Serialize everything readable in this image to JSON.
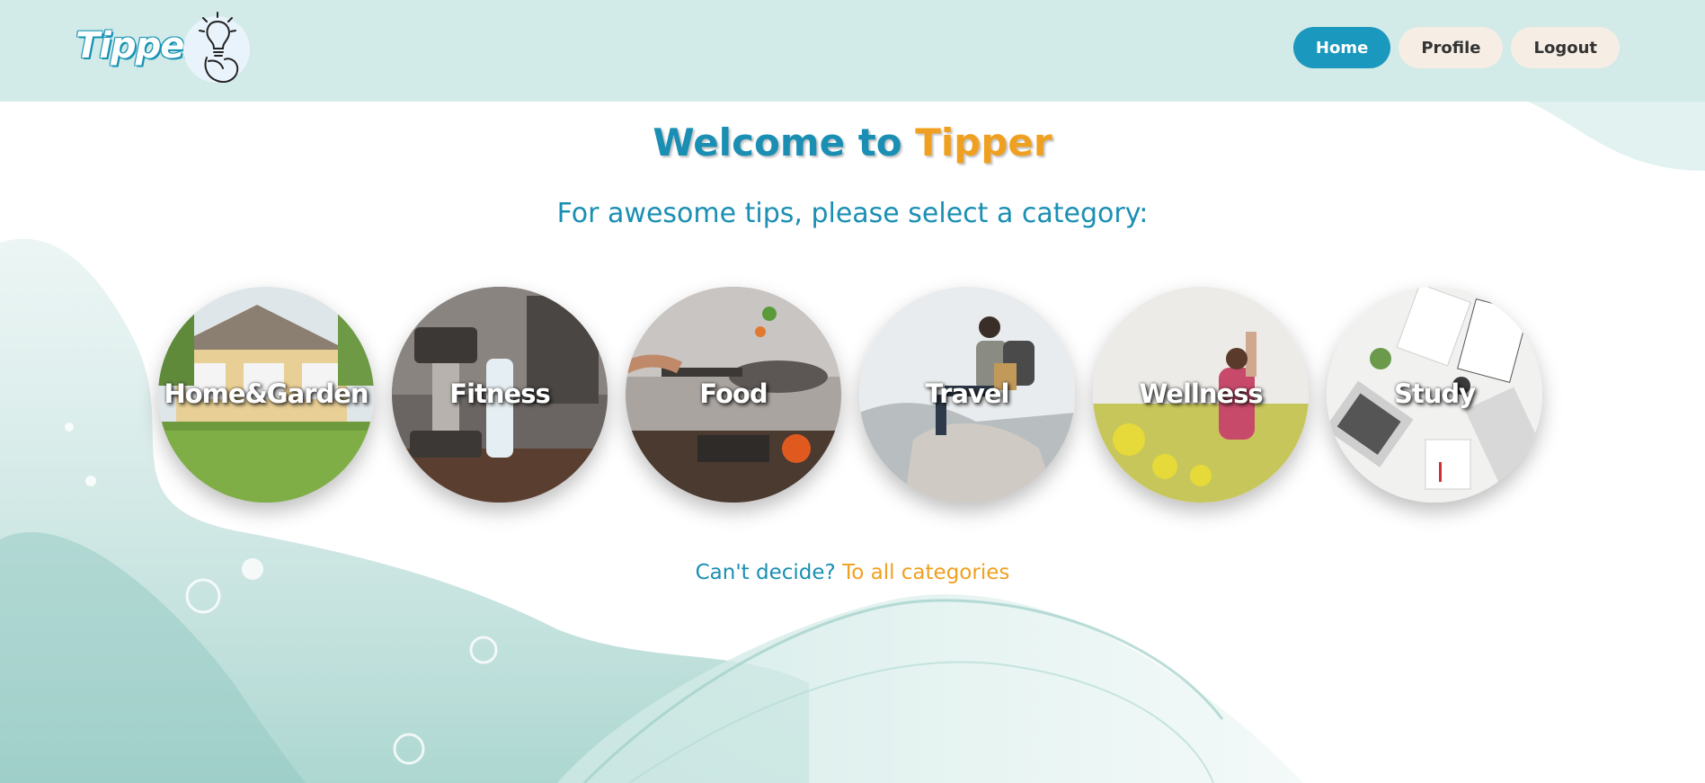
{
  "brand": {
    "name": "Tipper",
    "logo_icon": "lightbulb-hand-icon"
  },
  "nav": {
    "home": "Home",
    "profile": "Profile",
    "logout": "Logout"
  },
  "hero": {
    "welcome_prefix": "Welcome to",
    "welcome_brand": "Tipper",
    "subtitle": "For awesome tips, please select a category:"
  },
  "categories": [
    {
      "label": "Home&Garden",
      "icon": "house-photo"
    },
    {
      "label": "Fitness",
      "icon": "dumbbell-photo"
    },
    {
      "label": "Food",
      "icon": "cooking-pan-photo"
    },
    {
      "label": "Travel",
      "icon": "hikers-photo"
    },
    {
      "label": "Wellness",
      "icon": "flower-field-photo"
    },
    {
      "label": "Study",
      "icon": "desk-laptop-photo"
    }
  ],
  "footer": {
    "prompt": "Can't decide?",
    "link": "To all categories"
  },
  "colors": {
    "header_bg": "#d2eae8",
    "accent_blue": "#1a98bd",
    "accent_orange": "#f0a020",
    "nav_btn_bg": "#f6eee4"
  }
}
